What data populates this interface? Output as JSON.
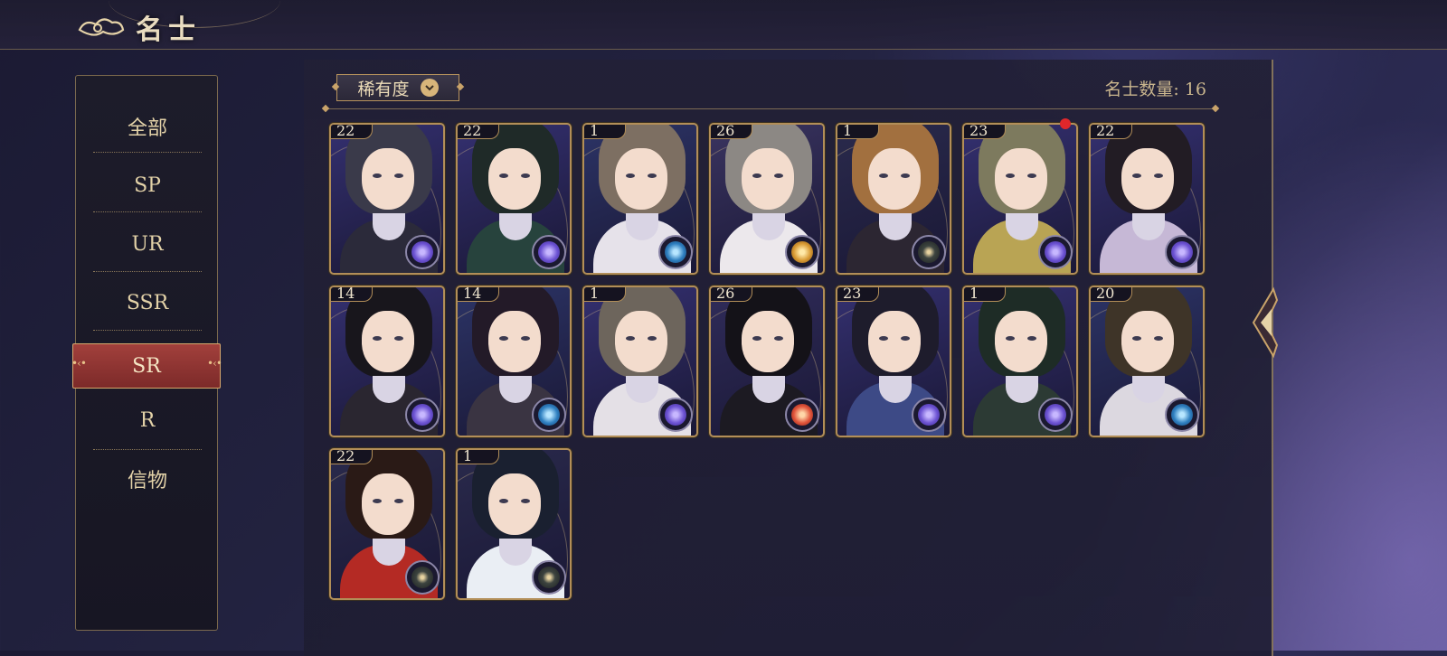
{
  "header": {
    "title": "名士",
    "title_icon": "cloud-swirl-icon"
  },
  "sidebar": {
    "items": [
      {
        "label": "全部",
        "active": false
      },
      {
        "label": "SP",
        "active": false
      },
      {
        "label": "UR",
        "active": false
      },
      {
        "label": "SSR",
        "active": false
      },
      {
        "label": "SR",
        "active": true
      },
      {
        "label": "R",
        "active": false
      },
      {
        "label": "信物",
        "active": false
      }
    ]
  },
  "toolbar": {
    "rarity_label": "稀有度",
    "rarity_icon": "chevron-down-icon",
    "count_label": "名士数量: 16"
  },
  "colors": {
    "accent_gold": "#c9a36a",
    "active_red": "#8f3432",
    "badge_red": "#e0272b"
  },
  "cards": [
    {
      "level": "22",
      "faction": "purple",
      "hair": "#3a3a4a",
      "outfit": "#2b2a3a"
    },
    {
      "level": "22",
      "faction": "purple",
      "hair": "#1f2a28",
      "outfit": "#27433d"
    },
    {
      "level": "1",
      "faction": "blue",
      "hair": "#7d6f62",
      "outfit": "#e6e2ea"
    },
    {
      "level": "26",
      "faction": "gold",
      "hair": "#8c8884",
      "outfit": "#ece8ec"
    },
    {
      "level": "1",
      "faction": "dark",
      "hair": "#a2703f",
      "outfit": "#2c2632"
    },
    {
      "level": "23",
      "faction": "purple",
      "hair": "#7d7a5e",
      "outfit": "#b9a454"
    },
    {
      "level": "22",
      "faction": "purple",
      "hair": "#221c24",
      "outfit": "#c6b8d6"
    },
    {
      "level": "14",
      "faction": "purple",
      "hair": "#18161c",
      "outfit": "#2a2630"
    },
    {
      "level": "14",
      "faction": "blue",
      "hair": "#231a28",
      "outfit": "#3a3442"
    },
    {
      "level": "1",
      "faction": "purple",
      "hair": "#6d655c",
      "outfit": "#e4e0e6"
    },
    {
      "level": "26",
      "faction": "red",
      "hair": "#141218",
      "outfit": "#1c1a22"
    },
    {
      "level": "23",
      "faction": "purple",
      "hair": "#1e1c2c",
      "outfit": "#3d4a86"
    },
    {
      "level": "1",
      "faction": "purple",
      "hair": "#1e2c26",
      "outfit": "#2c3a34"
    },
    {
      "level": "20",
      "faction": "blue",
      "hair": "#3e3428",
      "outfit": "#dcd8e0"
    },
    {
      "level": "22",
      "faction": "dark",
      "hair": "#2a1a16",
      "outfit": "#b42a24"
    },
    {
      "level": "1",
      "faction": "dark",
      "hair": "#1a2030",
      "outfit": "#eaeef4"
    }
  ],
  "notification": {
    "has_badge": true
  }
}
